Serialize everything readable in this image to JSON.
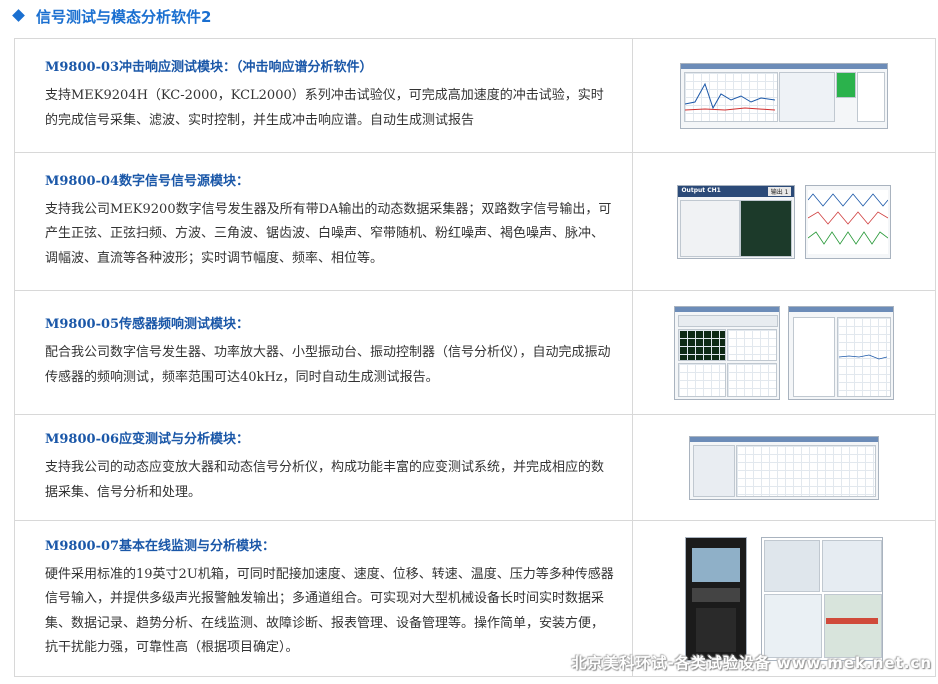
{
  "header": {
    "title": "信号测试与模态分析软件2",
    "icon": "diamond-icon",
    "accent": "#1a6fd0"
  },
  "modules": [
    {
      "title": "M9800-03冲击响应测试模块：（冲击响应谱分析软件）",
      "description": "支持MEK9204H（KC-2000，KCL2000）系列冲击试验仪，可完成高加速度的冲击试验，实时的完成信号采集、滤波、实时控制，并生成冲击响应谱。自动生成测试报告"
    },
    {
      "title": "M9800-04数字信号信号源模块：",
      "description": "支持我公司MEK9200数字信号发生器及所有带DA输出的动态数据采集器；双路数字信号输出，可产生正弦、正弦扫频、方波、三角波、锯齿波、白噪声、窄带随机、粉红噪声、褐色噪声、脉冲、调幅波、直流等各种波形；实时调节幅度、频率、相位等。",
      "shot": {
        "window_title": "Output CH1",
        "button": "输出 1"
      }
    },
    {
      "title": "M9800-05传感器频响测试模块：",
      "description": "配合我公司数字信号发生器、功率放大器、小型振动台、振动控制器（信号分析仪），自动完成振动传感器的频响测试，频率范围可达40kHz，同时自动生成测试报告。"
    },
    {
      "title": "M9800-06应变测试与分析模块：",
      "description": "支持我公司的动态应变放大器和动态信号分析仪，构成功能丰富的应变测试系统，并完成相应的数据采集、信号分析和处理。"
    },
    {
      "title": "M9800-07基本在线监测与分析模块：",
      "description": "硬件采用标准的19英寸2U机箱，可同时配接加速度、速度、位移、转速、温度、压力等多种传感器信号输入，并提供多级声光报警触发输出；多通道组合。可实现对大型机械设备长时间实时数据采集、数据记录、趋势分析、在线监测、故障诊断、报表管理、设备管理等。操作简单，安装方便，抗干扰能力强，可靠性高（根据项目确定）。"
    }
  ],
  "watermark": "北京美科环试-各类试验设备 www.mek.net.cn"
}
